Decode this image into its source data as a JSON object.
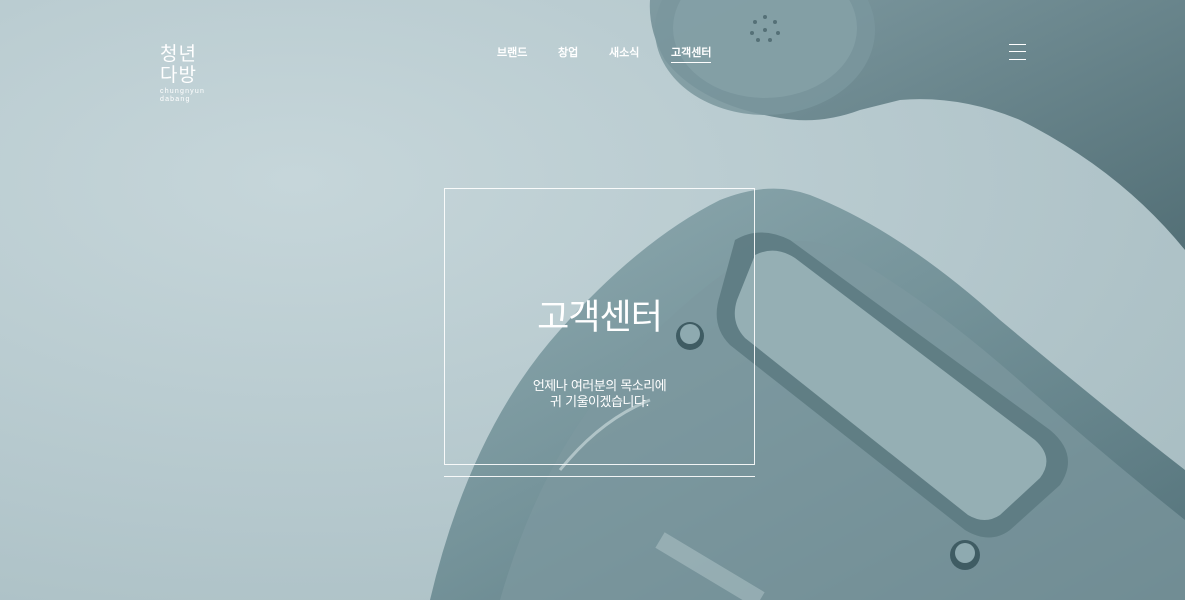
{
  "brand": {
    "logo_line1": "청년",
    "logo_line2": "다방",
    "logo_line3": "chungnyun",
    "logo_line4": "dabang"
  },
  "nav": {
    "items": [
      {
        "label": "브랜드"
      },
      {
        "label": "창업"
      },
      {
        "label": "새소식"
      },
      {
        "label": "고객센터",
        "active": true
      }
    ]
  },
  "menu": {
    "icon": "hamburger-menu-icon"
  },
  "hero": {
    "title": "고객센터",
    "desc_line1": "언제나 여러분의 목소리에",
    "desc_line2": "귀 기울이겠습니다.",
    "image": "rotary-telephone-photo"
  },
  "colors": {
    "background": "#b3c6cb",
    "text": "#ffffff",
    "phone": "#6c8a90"
  }
}
